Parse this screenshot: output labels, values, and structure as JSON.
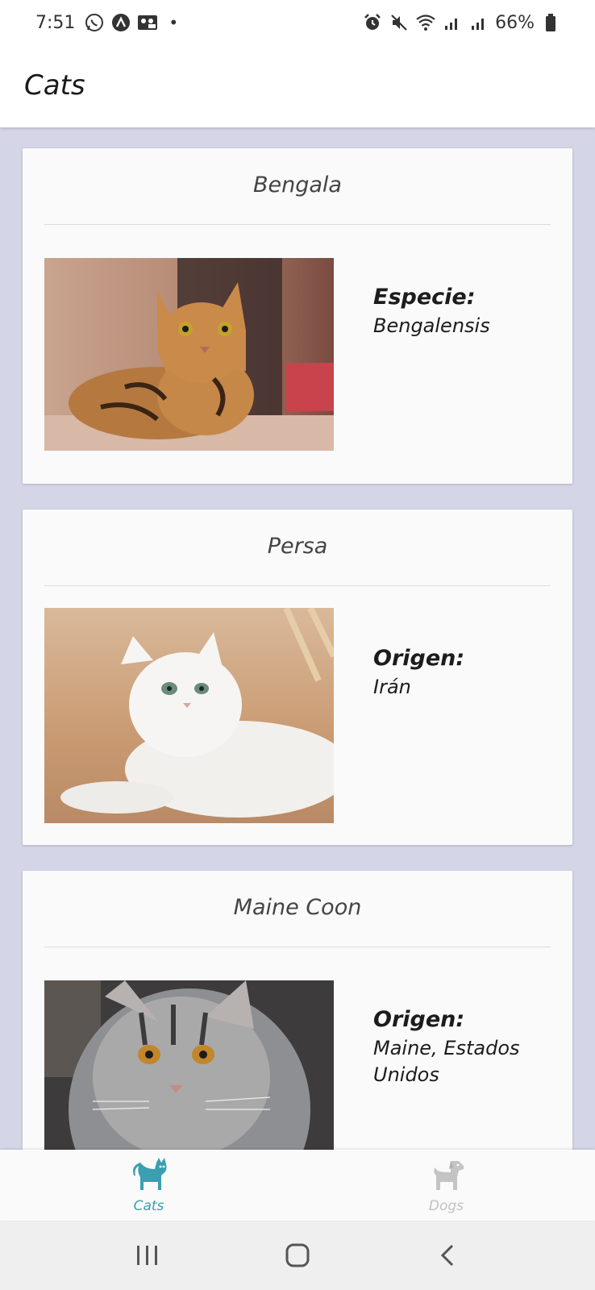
{
  "status_bar": {
    "time": "7:51",
    "battery": "66%"
  },
  "header": {
    "title": "Cats"
  },
  "cards": [
    {
      "title": "Bengala",
      "label": "Especie:",
      "value": "Bengalensis",
      "photo": "bengal-cat-photo"
    },
    {
      "title": "Persa",
      "label": "Origen:",
      "value": "Irán",
      "photo": "persian-cat-photo"
    },
    {
      "title": "Maine Coon",
      "label": "Origen:",
      "value": "Maine, Estados Unidos",
      "photo": "maine-coon-cat-photo"
    }
  ],
  "bottom_nav": {
    "items": [
      {
        "label": "Cats",
        "icon": "cat-icon",
        "active": true
      },
      {
        "label": "Dogs",
        "icon": "dog-icon",
        "active": false
      }
    ]
  },
  "colors": {
    "accent": "#3a9fb0",
    "background": "#d5d5e8",
    "card": "#fafafa"
  }
}
